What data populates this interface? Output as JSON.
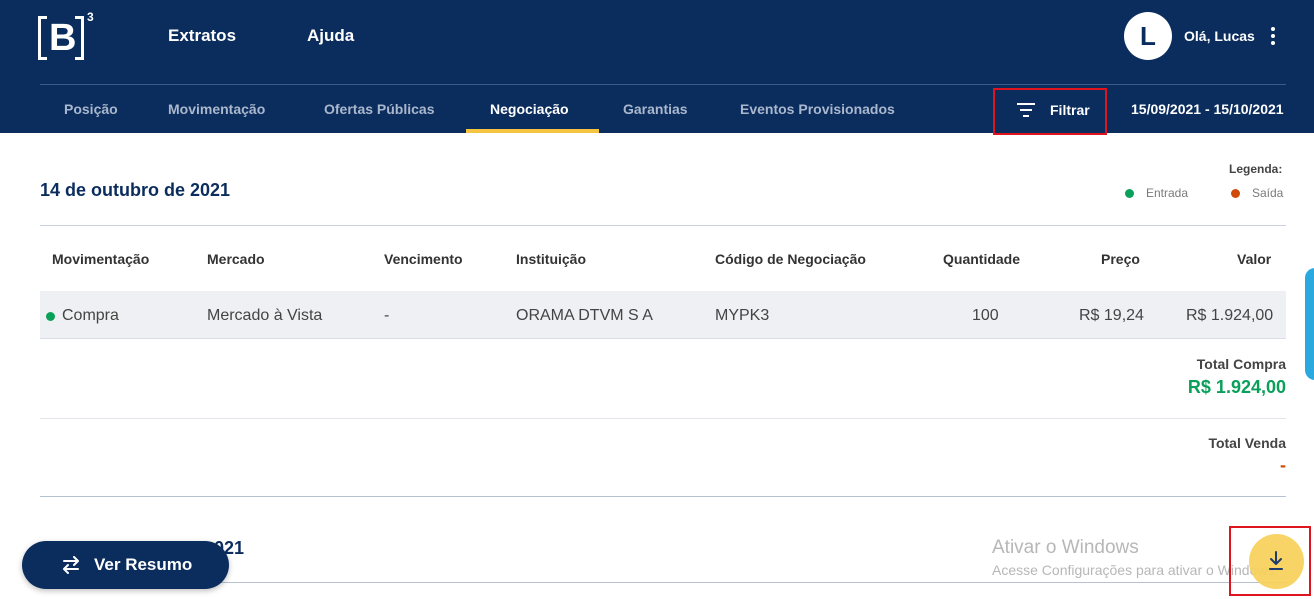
{
  "header": {
    "logo_text": "B",
    "logo_sup": "3",
    "nav": [
      "Extratos",
      "Ajuda"
    ],
    "avatar_initial": "L",
    "greeting": "Olá, Lucas"
  },
  "tabs": [
    {
      "label": "Posição",
      "active": false
    },
    {
      "label": "Movimentação",
      "active": false
    },
    {
      "label": "Ofertas Públicas",
      "active": false
    },
    {
      "label": "Negociação",
      "active": true
    },
    {
      "label": "Garantias",
      "active": false
    },
    {
      "label": "Eventos Provisionados",
      "active": false
    }
  ],
  "filter": {
    "label": "Filtrar",
    "icon": "filter-icon"
  },
  "date_range": "15/09/2021 - 15/10/2021",
  "legend": {
    "title": "Legenda:",
    "items": [
      {
        "label": "Entrada",
        "color": "#0aa05a"
      },
      {
        "label": "Saída",
        "color": "#d04a0a"
      }
    ]
  },
  "section": {
    "date": "14 de outubro de 2021",
    "columns": [
      "Movimentação",
      "Mercado",
      "Vencimento",
      "Instituição",
      "Código de Negociação",
      "Quantidade",
      "Preço",
      "Valor"
    ],
    "rows": [
      {
        "movimentacao": "Compra",
        "mercado": "Mercado à Vista",
        "vencimento": "-",
        "instituicao": "ORAMA DTVM S A",
        "codigo": "MYPK3",
        "quantidade": "100",
        "preco": "R$ 19,24",
        "valor": "R$ 1.924,00",
        "type_color": "#0aa05a"
      }
    ],
    "total_compra": {
      "label": "Total Compra",
      "value": "R$ 1.924,00",
      "color": "#0aa05a"
    },
    "total_venda": {
      "label": "Total Venda",
      "value": "-",
      "color": "#d04a0a"
    }
  },
  "next_section_date_partial": "021",
  "ver_resumo": {
    "label": "Ver Resumo",
    "icon": "swap-arrows-icon"
  },
  "watermark": {
    "title": "Ativar o Windows",
    "subtitle": "Acesse Configurações para ativar o Windows."
  },
  "download": {
    "icon": "download-icon"
  },
  "colors": {
    "navy": "#0b2d5e",
    "accent": "#f5c542",
    "entrada": "#0aa05a",
    "saida": "#d04a0a"
  }
}
